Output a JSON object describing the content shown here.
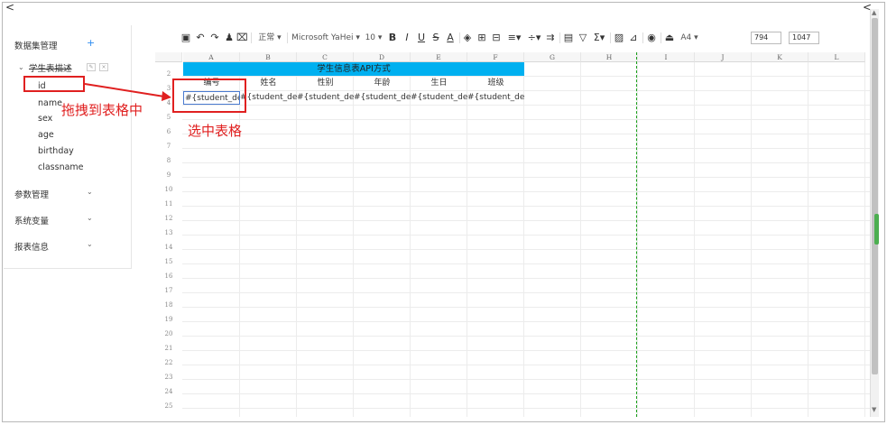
{
  "nav": {
    "back_left": "<",
    "back_right": "<"
  },
  "left_panel": {
    "dataset_title": "数据集管理",
    "add_symbol": "+",
    "dataset_name": "学生表描述",
    "fields": [
      "id",
      "name",
      "sex",
      "age",
      "birthday",
      "classname"
    ],
    "sections": [
      "参数管理",
      "系统变量",
      "报表信息"
    ]
  },
  "annotations": {
    "drag_hint": "拖拽到表格中",
    "select_hint": "选中表格"
  },
  "toolbar": {
    "style_select": "正常 ▾",
    "font_select": "Microsoft YaHei ▾",
    "size_select": "10 ▾",
    "paper_select": "A4 ▾",
    "width_value": "794",
    "height_value": "1047"
  },
  "sheet": {
    "columns": [
      "A",
      "B",
      "C",
      "D",
      "E",
      "F",
      "G",
      "H",
      "I",
      "J",
      "K",
      "L"
    ],
    "rows": [
      "",
      "2",
      "3",
      "4",
      "5",
      "6",
      "7",
      "8",
      "9",
      "10",
      "11",
      "12",
      "13",
      "14",
      "15",
      "16",
      "17",
      "18",
      "19",
      "20",
      "21",
      "22",
      "23",
      "24",
      "25",
      "26"
    ],
    "title": "学生信息表API方式",
    "headers": [
      "编号",
      "姓名",
      "性别",
      "年龄",
      "生日",
      "班级"
    ],
    "data_row": [
      "#{student_desc",
      "#{student_desc",
      "#{student_desc",
      "#{student_desc",
      "#{student_desc",
      "#{student_desc"
    ]
  }
}
